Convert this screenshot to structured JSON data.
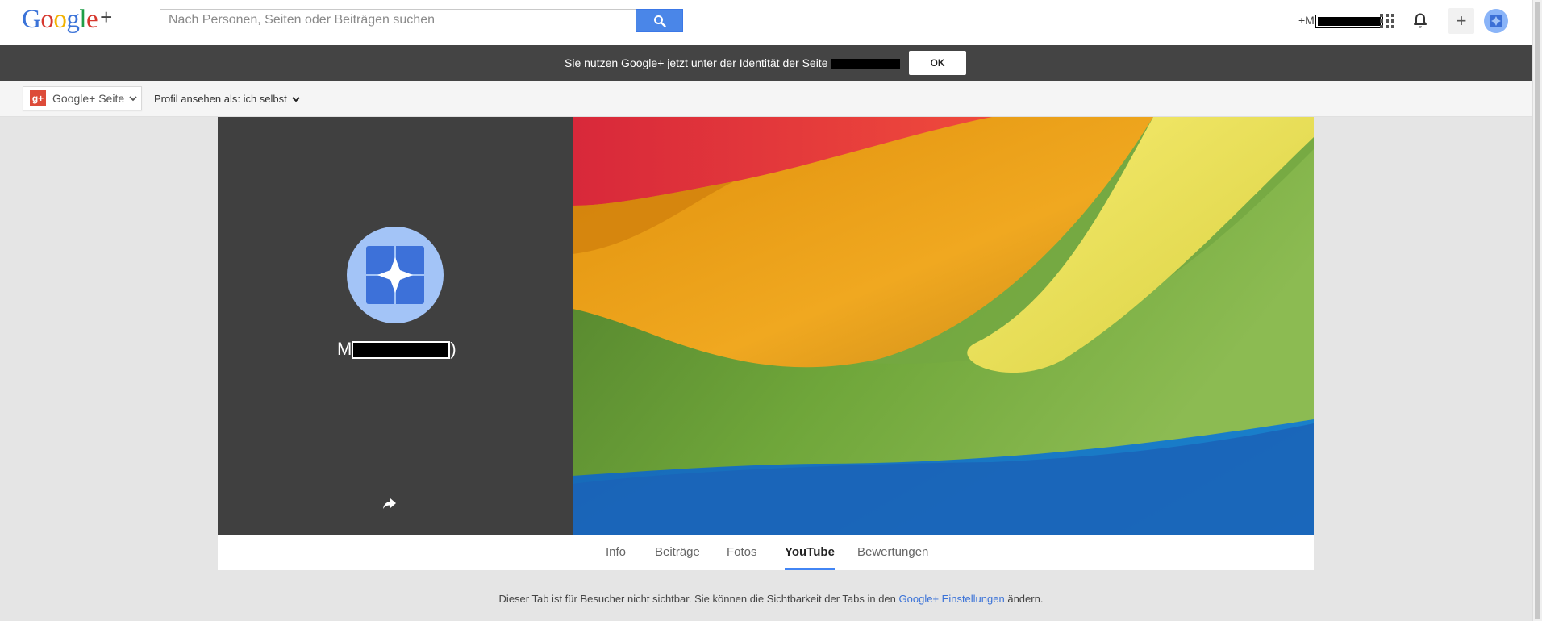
{
  "topbar": {
    "logo": {
      "letters": [
        "G",
        "o",
        "o",
        "g",
        "l",
        "e"
      ],
      "plus": "+"
    },
    "search_placeholder": "Nach Personen, Seiten oder Beiträgen suchen",
    "user_name_prefix": "+M",
    "icons": [
      "search-icon",
      "apps-grid-icon",
      "bell-icon",
      "plus-icon",
      "avatar"
    ]
  },
  "notice": {
    "text": "Sie nutzen Google+ jetzt unter der Identität der Seite",
    "ok_label": "OK"
  },
  "subbar": {
    "page_switch_label": "Google+ Seite",
    "page_switch_badge": "g+",
    "view_as_label": "Profil ansehen als:",
    "view_as_value": "ich selbst"
  },
  "profile": {
    "name_prefix": "M",
    "name_suffix": ")"
  },
  "tabs": [
    {
      "label": "Info",
      "active": false
    },
    {
      "label": "Beiträge",
      "active": false
    },
    {
      "label": "Fotos",
      "active": false
    },
    {
      "label": "YouTube",
      "active": true
    },
    {
      "label": "Bewertungen",
      "active": false
    }
  ],
  "hint": {
    "before": "Dieser Tab ist für Besucher nicht sichtbar. Sie können die Sichtbarkeit der Tabs in den",
    "link": "Google+ Einstellungen",
    "after": "ändern."
  },
  "colors": {
    "accent_blue": "#4285f4",
    "gplus_red": "#dd4b39",
    "notice_bg": "#444444",
    "profile_panel": "#404040"
  }
}
